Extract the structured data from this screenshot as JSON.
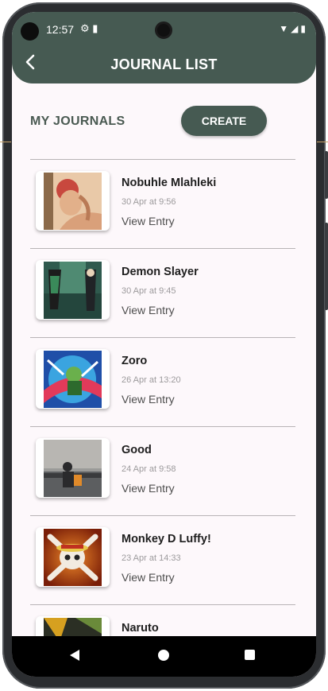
{
  "status_bar": {
    "time": "12:57",
    "left_icons": [
      "gear-icon",
      "sd-card-icon"
    ],
    "right_icons": [
      "wifi-icon",
      "signal-icon",
      "battery-icon"
    ]
  },
  "header": {
    "title": "JOURNAL LIST",
    "back_icon": "chevron-left-icon",
    "background": "#465a52"
  },
  "section": {
    "title": "MY JOURNALS",
    "create_label": "CREATE"
  },
  "journals": [
    {
      "title": "Nobuhle Mlahleki",
      "date": "30 Apr at 9:56",
      "link": "View Entry"
    },
    {
      "title": "Demon Slayer",
      "date": "30 Apr at 9:45",
      "link": "View Entry"
    },
    {
      "title": "Zoro",
      "date": "26 Apr at 13:20",
      "link": "View Entry"
    },
    {
      "title": "Good",
      "date": "24 Apr at 9:58",
      "link": "View Entry"
    },
    {
      "title": "Monkey D Luffy!",
      "date": "23 Apr at 14:33",
      "link": "View Entry"
    },
    {
      "title": "Naruto",
      "date": "",
      "link": ""
    }
  ],
  "nav_bar": {
    "icons": [
      "back-triangle-icon",
      "home-circle-icon",
      "recents-square-icon"
    ]
  },
  "colors": {
    "accent": "#465a52",
    "screen_bg": "#fdf8fb"
  }
}
